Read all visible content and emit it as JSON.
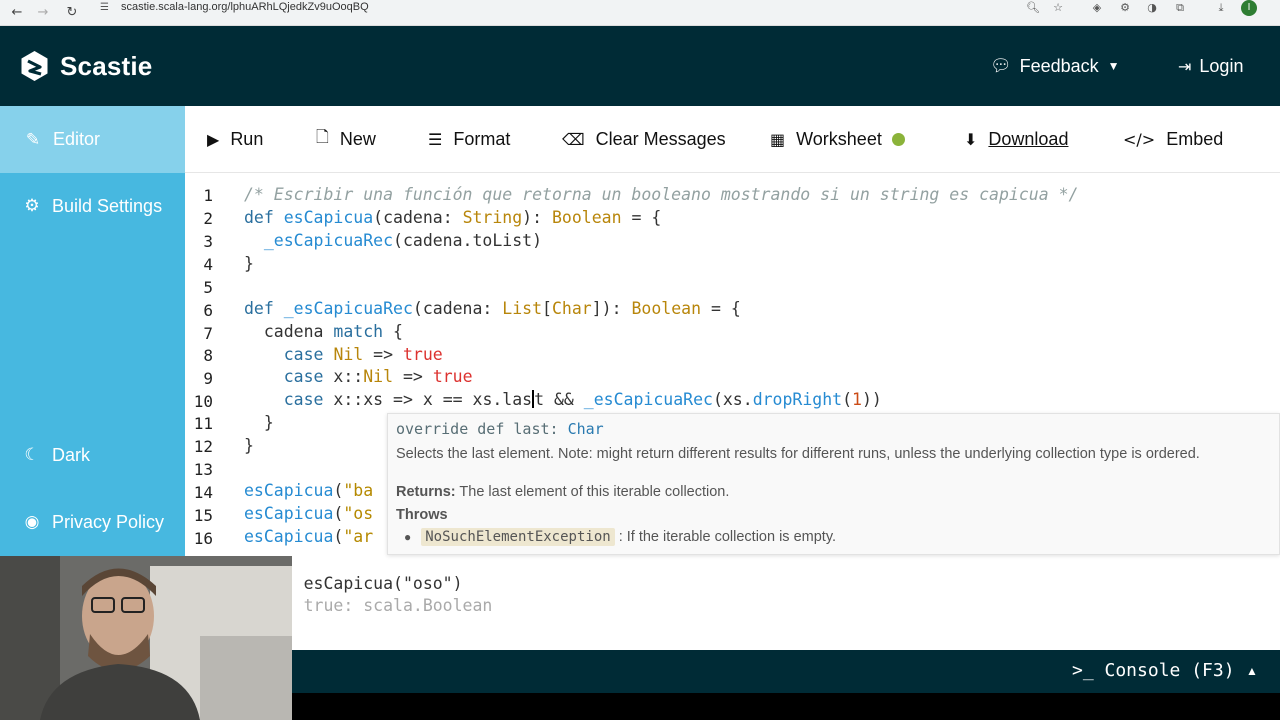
{
  "browser": {
    "url": "scastie.scala-lang.org/lphuARhLQjedkZv9uOoqBQ",
    "profile_initial": "I"
  },
  "app": {
    "name": "Scastie",
    "feedback_label": "Feedback",
    "login_label": "Login"
  },
  "sidebar": {
    "items": [
      {
        "label": "Editor",
        "icon": "edit-icon",
        "active": true
      },
      {
        "label": "Build Settings",
        "icon": "gear-icon"
      },
      {
        "label": "Dark",
        "icon": "moon-icon"
      },
      {
        "label": "Privacy Policy",
        "icon": "user-secret-icon"
      }
    ]
  },
  "toolbar": {
    "run": "Run",
    "new": "New",
    "format": "Format",
    "clear_messages": "Clear Messages",
    "worksheet": "Worksheet",
    "worksheet_status_color": "#8bb33a",
    "download": "Download",
    "embed": "Embed"
  },
  "editor": {
    "line_numbers": [
      "1",
      "2",
      "3",
      "4",
      "5",
      "6",
      "7",
      "8",
      "9",
      "10",
      "11",
      "12",
      "13",
      "14",
      "15",
      "16"
    ],
    "lines": [
      "/* Escribir una función que retorna un booleano mostrando si un string es capicua */",
      "def esCapicua(cadena: String): Boolean = {",
      "  _esCapicuaRec(cadena.toList)",
      "}",
      "",
      "def _esCapicuaRec(cadena: List[Char]): Boolean = {",
      "  cadena match {",
      "    case Nil => true",
      "    case x::Nil => true",
      "    case x::xs => x == xs.last && _esCapicuaRec(xs.dropRight(1))",
      "  }",
      "}",
      "",
      "esCapicua(\"ba",
      "esCapicua(\"os",
      "esCapicua(\"ar"
    ],
    "overflow_line": "esCapicua(\"oso\")",
    "overflow_result": "true: scala.Boolean"
  },
  "tooltip": {
    "signature_prefix": "override def last: ",
    "signature_type": "Char",
    "description": "Selects the last element. Note: might return different results for different runs, unless the underlying collection type is ordered.",
    "returns_label": "Returns:",
    "returns_text": "The last element of this iterable collection.",
    "throws_label": "Throws",
    "exception_name": "NoSuchElementException",
    "exception_text": ": If the iterable collection is empty."
  },
  "console": {
    "label": ">_ Console (F3)"
  }
}
